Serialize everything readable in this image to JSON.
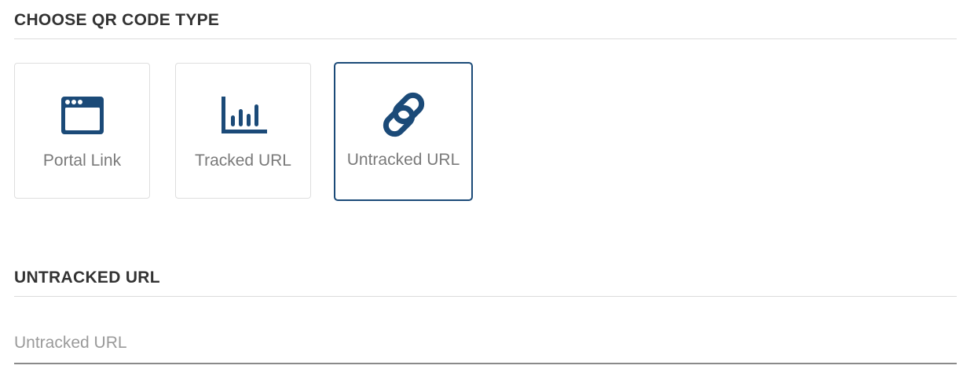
{
  "qr_type_section": {
    "title": "CHOOSE QR CODE TYPE",
    "options": [
      {
        "label": "Portal Link",
        "icon": "browser-window-icon",
        "selected": false
      },
      {
        "label": "Tracked URL",
        "icon": "bar-chart-icon",
        "selected": false
      },
      {
        "label": "Untracked URL",
        "icon": "link-icon",
        "selected": true
      }
    ]
  },
  "untracked_section": {
    "title": "UNTRACKED URL",
    "input": {
      "value": "",
      "placeholder": "Untracked URL"
    }
  },
  "colors": {
    "accent": "#1b4a78",
    "icon": "#1b4a78",
    "label": "#7a7a7a",
    "heading": "#333333"
  }
}
